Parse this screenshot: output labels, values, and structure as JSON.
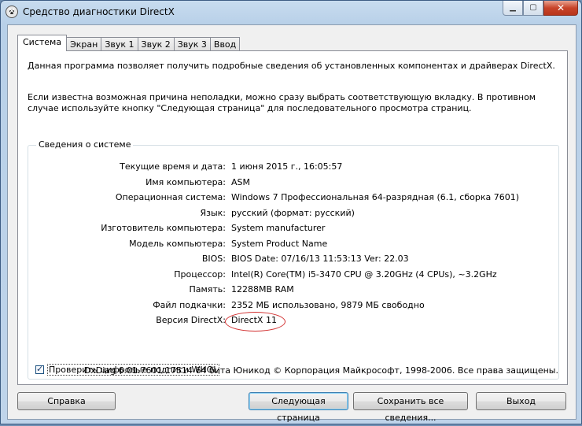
{
  "window": {
    "title": "Средство диагностики DirectX"
  },
  "tabs": [
    {
      "label": "Система",
      "active": true
    },
    {
      "label": "Экран"
    },
    {
      "label": "Звук 1"
    },
    {
      "label": "Звук 2"
    },
    {
      "label": "Звук 3"
    },
    {
      "label": "Ввод"
    }
  ],
  "intro": {
    "line1": "Данная программа позволяет получить подробные сведения об установленных компонентах и драйверах DirectX.",
    "line2": "Если известна возможная причина неполадки, можно сразу выбрать соответствующую вкладку. В противном случае используйте кнопку \"Следующая страница\" для последовательного просмотра страниц."
  },
  "system_info": {
    "group_title": "Сведения о системе",
    "rows": [
      {
        "label": "Текущие время и дата:",
        "value": "1 июня 2015 г., 16:05:57"
      },
      {
        "label": "Имя компьютера:",
        "value": "ASM"
      },
      {
        "label": "Операционная система:",
        "value": "Windows 7 Профессиональная 64-разрядная (6.1, сборка 7601)"
      },
      {
        "label": "Язык:",
        "value": "русский (формат: русский)"
      },
      {
        "label": "Изготовитель компьютера:",
        "value": "System manufacturer"
      },
      {
        "label": "Модель компьютера:",
        "value": "System Product Name"
      },
      {
        "label": "BIOS:",
        "value": "BIOS Date: 07/16/13 11:53:13 Ver: 22.03"
      },
      {
        "label": "Процессор:",
        "value": "Intel(R) Core(TM) i5-3470 CPU @ 3.20GHz (4 CPUs), ~3.2GHz"
      },
      {
        "label": "Память:",
        "value": "12288MB RAM"
      },
      {
        "label": "Файл подкачки:",
        "value": "2352 МБ использовано, 9879 МБ свободно"
      },
      {
        "label": "Версия DirectX:",
        "value": "DirectX 11"
      }
    ]
  },
  "whql": {
    "label": "Проверить цифровые подписи WHQL",
    "checked": true
  },
  "footer": {
    "text": "DxDiag 6.01.7601.17514 64 бита Юникод  © Корпорация Майкрософт, 1998-2006.  Все права защищены."
  },
  "buttons": {
    "help": "Справка",
    "next": "Следующая страница",
    "save": "Сохранить все сведения...",
    "exit": "Выход"
  },
  "colors": {
    "annotation": "#d23030"
  }
}
